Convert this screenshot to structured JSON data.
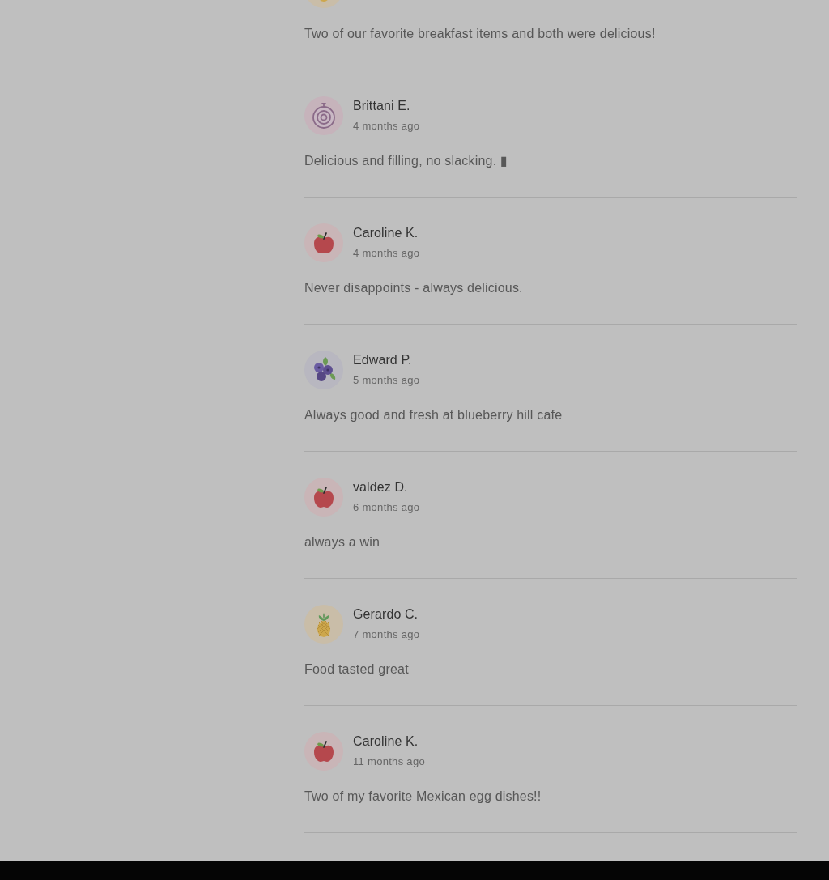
{
  "reviews": [
    {
      "kind": "pineapple",
      "comment": "Two of our favorite breakfast items and both were delicious!"
    },
    {
      "kind": "onion",
      "name": "Brittani E.",
      "time": "4 months ago",
      "comment": "Delicious and filling, no slacking. ▮"
    },
    {
      "kind": "apple",
      "name": "Caroline K.",
      "time": "4 months ago",
      "comment": "Never disappoints - always delicious."
    },
    {
      "kind": "blueberry",
      "name": "Edward P.",
      "time": "5 months ago",
      "comment": "Always good and fresh at blueberry hill cafe"
    },
    {
      "kind": "apple",
      "name": "valdez D.",
      "time": "6 months ago",
      "comment": "always a win"
    },
    {
      "kind": "pineapple",
      "name": "Gerardo C.",
      "time": "7 months ago",
      "comment": "Food tasted great"
    },
    {
      "kind": "apple",
      "name": "Caroline K.",
      "time": "11 months ago",
      "comment": "Two of my favorite Mexican egg dishes!!"
    }
  ]
}
